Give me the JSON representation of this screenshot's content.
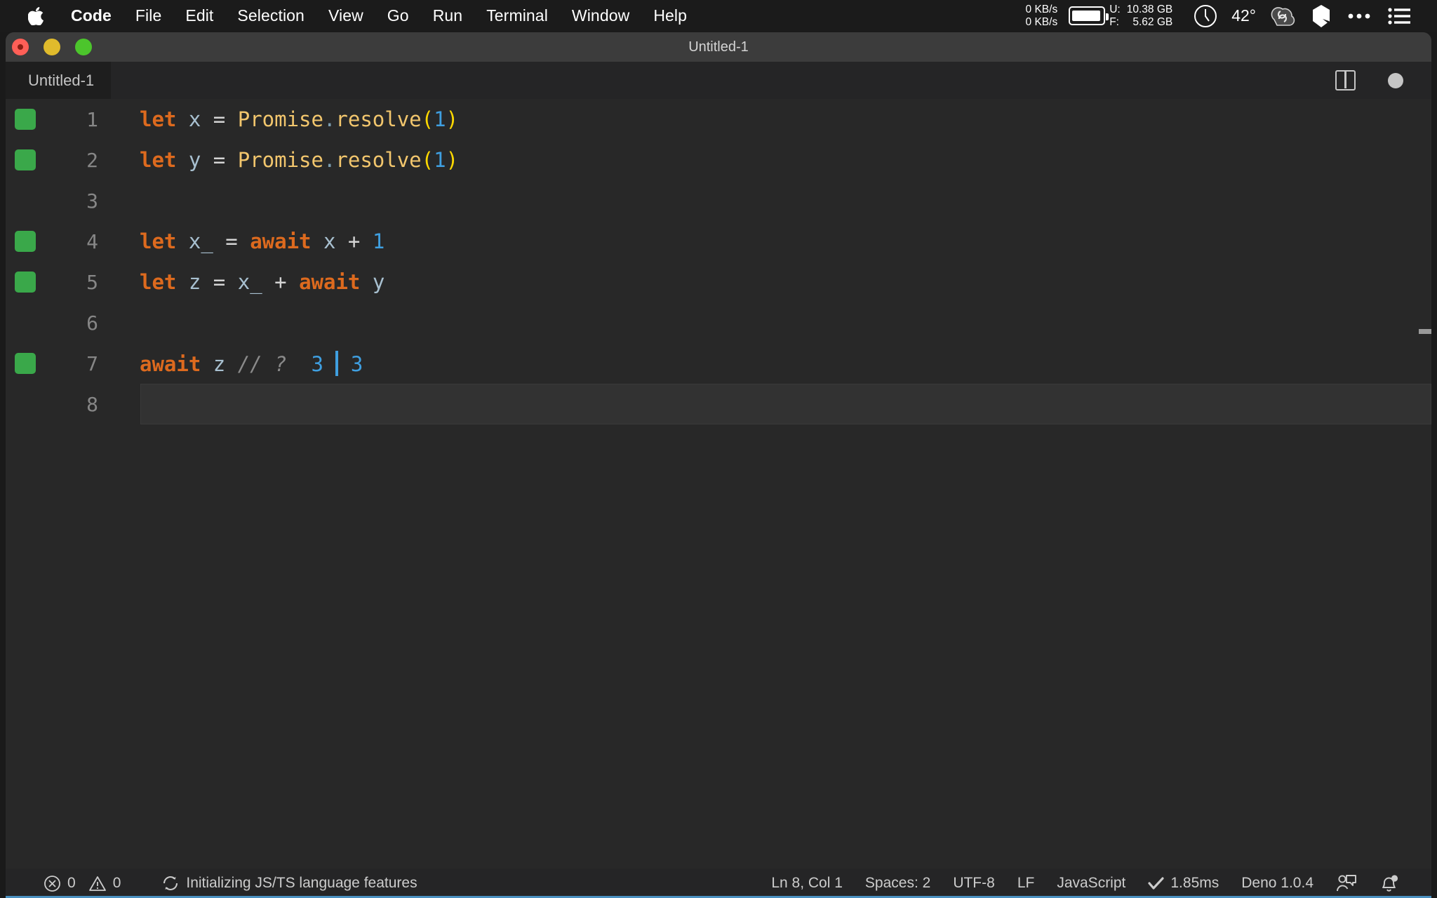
{
  "menubar": {
    "apple_icon": "apple-logo",
    "items": [
      {
        "label": "Code",
        "bold": true
      },
      {
        "label": "File",
        "bold": false
      },
      {
        "label": "Edit",
        "bold": false
      },
      {
        "label": "Selection",
        "bold": false
      },
      {
        "label": "View",
        "bold": false
      },
      {
        "label": "Go",
        "bold": false
      },
      {
        "label": "Run",
        "bold": false
      },
      {
        "label": "Terminal",
        "bold": false
      },
      {
        "label": "Window",
        "bold": false
      },
      {
        "label": "Help",
        "bold": false
      }
    ],
    "status": {
      "net_up": "0 KB/s",
      "net_down": "0 KB/s",
      "battery_icon": "battery-icon",
      "mem_used_label": "U:",
      "mem_used_value": "10.38 GB",
      "mem_free_label": "F:",
      "mem_free_value": "5.62 GB",
      "clock_icon": "clock-icon",
      "temperature": "42°",
      "cloud_icon": "cloud-sync-icon",
      "shield_icon": "shield-icon",
      "more_icon": "ellipsis-icon",
      "list_icon": "list-menu-icon"
    }
  },
  "window": {
    "title": "Untitled-1",
    "traffic_lights": [
      "close-button",
      "minimize-button",
      "maximize-button"
    ]
  },
  "tabbar": {
    "tabs": [
      {
        "label": "Untitled-1",
        "active": true
      }
    ],
    "actions": {
      "split_icon": "split-editor-icon",
      "dirty_indicator": "unsaved-changes-dot"
    }
  },
  "editor": {
    "cursor_line": 8,
    "lines": [
      {
        "number": "1",
        "marked": true,
        "tokens": [
          {
            "text": "let",
            "type": "kw"
          },
          {
            "text": " ",
            "type": "txt"
          },
          {
            "text": "x",
            "type": "var"
          },
          {
            "text": " ",
            "type": "txt"
          },
          {
            "text": "=",
            "type": "op"
          },
          {
            "text": " ",
            "type": "txt"
          },
          {
            "text": "Promise",
            "type": "fn"
          },
          {
            "text": ".",
            "type": "dot"
          },
          {
            "text": "resolve",
            "type": "fn"
          },
          {
            "text": "(",
            "type": "paren"
          },
          {
            "text": "1",
            "type": "num"
          },
          {
            "text": ")",
            "type": "paren"
          }
        ]
      },
      {
        "number": "2",
        "marked": true,
        "tokens": [
          {
            "text": "let",
            "type": "kw"
          },
          {
            "text": " ",
            "type": "txt"
          },
          {
            "text": "y",
            "type": "var"
          },
          {
            "text": " ",
            "type": "txt"
          },
          {
            "text": "=",
            "type": "op"
          },
          {
            "text": " ",
            "type": "txt"
          },
          {
            "text": "Promise",
            "type": "fn"
          },
          {
            "text": ".",
            "type": "dot"
          },
          {
            "text": "resolve",
            "type": "fn"
          },
          {
            "text": "(",
            "type": "paren"
          },
          {
            "text": "1",
            "type": "num"
          },
          {
            "text": ")",
            "type": "paren"
          }
        ]
      },
      {
        "number": "3",
        "marked": false,
        "tokens": []
      },
      {
        "number": "4",
        "marked": true,
        "tokens": [
          {
            "text": "let",
            "type": "kw"
          },
          {
            "text": " ",
            "type": "txt"
          },
          {
            "text": "x_",
            "type": "var"
          },
          {
            "text": " ",
            "type": "txt"
          },
          {
            "text": "=",
            "type": "op"
          },
          {
            "text": " ",
            "type": "txt"
          },
          {
            "text": "await",
            "type": "kw"
          },
          {
            "text": " ",
            "type": "txt"
          },
          {
            "text": "x",
            "type": "var"
          },
          {
            "text": " ",
            "type": "txt"
          },
          {
            "text": "+",
            "type": "op"
          },
          {
            "text": " ",
            "type": "txt"
          },
          {
            "text": "1",
            "type": "num"
          }
        ]
      },
      {
        "number": "5",
        "marked": true,
        "tokens": [
          {
            "text": "let",
            "type": "kw"
          },
          {
            "text": " ",
            "type": "txt"
          },
          {
            "text": "z",
            "type": "var"
          },
          {
            "text": " ",
            "type": "txt"
          },
          {
            "text": "=",
            "type": "op"
          },
          {
            "text": " ",
            "type": "txt"
          },
          {
            "text": "x_",
            "type": "var"
          },
          {
            "text": " ",
            "type": "txt"
          },
          {
            "text": "+",
            "type": "op"
          },
          {
            "text": " ",
            "type": "txt"
          },
          {
            "text": "await",
            "type": "kw"
          },
          {
            "text": " ",
            "type": "txt"
          },
          {
            "text": "y",
            "type": "var"
          }
        ]
      },
      {
        "number": "6",
        "marked": false,
        "tokens": []
      },
      {
        "number": "7",
        "marked": true,
        "tokens": [
          {
            "text": "await",
            "type": "kw"
          },
          {
            "text": " ",
            "type": "txt"
          },
          {
            "text": "z",
            "type": "var"
          },
          {
            "text": " ",
            "type": "txt"
          },
          {
            "text": "//",
            "type": "cmt"
          },
          {
            "text": " ",
            "type": "txt"
          },
          {
            "text": "?",
            "type": "cmt"
          },
          {
            "text": "  ",
            "type": "txt"
          },
          {
            "text": "3",
            "type": "num"
          },
          {
            "text": " ",
            "type": "txt"
          },
          {
            "text": "",
            "type": "cursor"
          },
          {
            "text": " ",
            "type": "txt"
          },
          {
            "text": "3",
            "type": "num"
          }
        ]
      },
      {
        "number": "8",
        "marked": false,
        "current": true,
        "tokens": []
      }
    ]
  },
  "statusbar": {
    "error_icon": "error-circle-icon",
    "error_count": "0",
    "warning_icon": "warning-triangle-icon",
    "warning_count": "0",
    "sync_icon": "sync-spinner-icon",
    "task_message": "Initializing JS/TS language features",
    "cursor_position": "Ln 8, Col 1",
    "indentation": "Spaces: 2",
    "encoding": "UTF-8",
    "eol": "LF",
    "language": "JavaScript",
    "timing_icon": "check-icon",
    "timing": "1.85ms",
    "runtime": "Deno 1.0.4",
    "feedback_icon": "feedback-person-icon",
    "bell_icon": "notification-bell-icon"
  },
  "colors": {
    "keyword": "#dd6a1e",
    "function": "#f2c66d",
    "number": "#3f9fe0",
    "comment": "#8a8a8a",
    "variable": "#a8c0d0",
    "paren": "#ffd900",
    "gutter_mark": "#3aa84a",
    "editor_bg": "#282828",
    "accent": "#4a90c0"
  }
}
